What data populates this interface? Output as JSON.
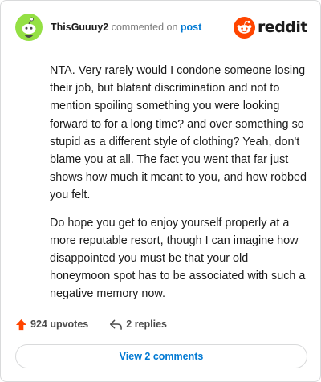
{
  "header": {
    "username": "ThisGuuuy2",
    "action_text": "commented on",
    "target_link": "post",
    "avatar_icon": "snoo-avatar-icon",
    "brand_icon": "reddit-logo-icon",
    "brand_text": "reddit"
  },
  "comment": {
    "paragraphs": [
      "NTA. Very rarely would I condone someone losing their job, but blatant discrimination and not to mention spoiling something you were looking forward to for a long time? and over something so stupid as a different style of clothing? Yeah, don't blame you at all. The fact you went that far just shows how much it meant to you, and how robbed you felt.",
      "Do hope you get to enjoy yourself properly at a more reputable resort, though I can imagine how disappointed you must be that your old honeymoon spot has to be associated with such a negative memory now."
    ]
  },
  "actions": {
    "upvotes_label": "924 upvotes",
    "upvote_icon": "upvote-arrow-icon",
    "replies_label": "2 replies",
    "reply_icon": "reply-arrow-icon"
  },
  "footer": {
    "view_comments_label": "View 2 comments"
  },
  "colors": {
    "link_blue": "#0079d3",
    "upvote_orange": "#ff4500",
    "avatar_green": "#94e044",
    "border": "#d9dadb"
  }
}
